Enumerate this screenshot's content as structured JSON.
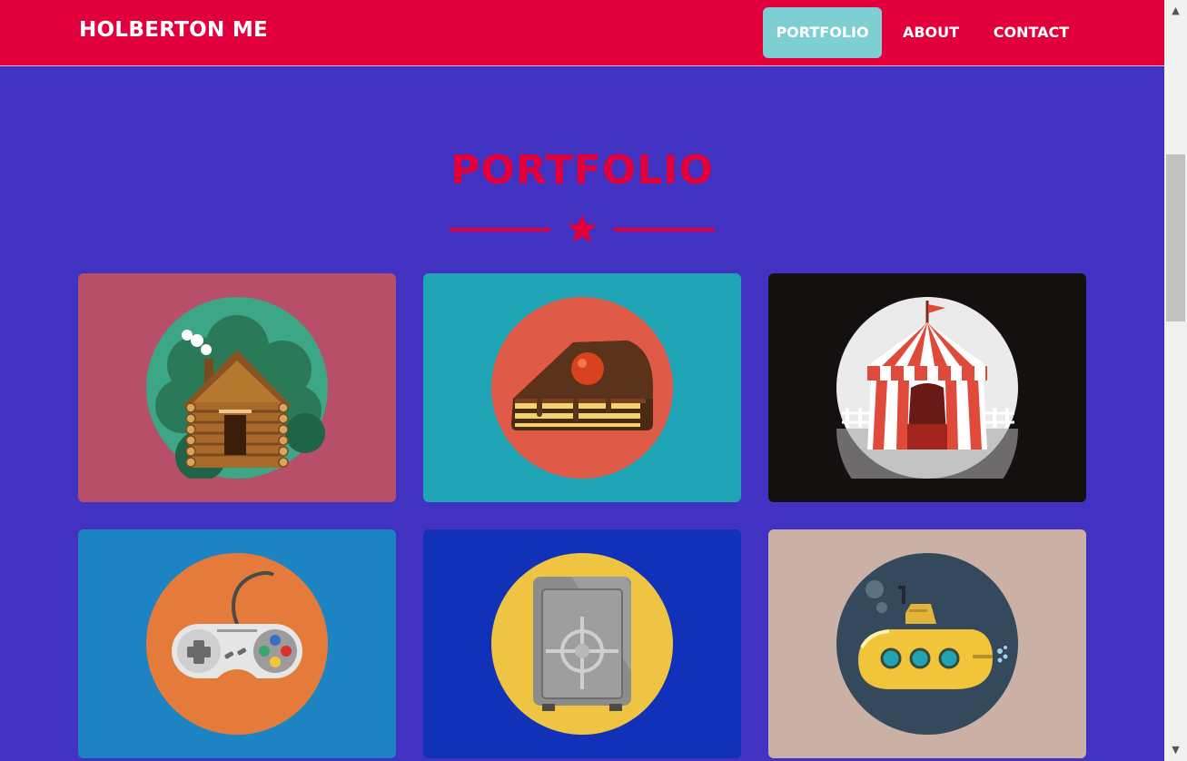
{
  "nav": {
    "brand": "HOLBERTON ME",
    "links": [
      {
        "label": "PORTFOLIO"
      },
      {
        "label": "ABOUT"
      },
      {
        "label": "CONTACT"
      }
    ]
  },
  "portfolio": {
    "title": "PORTFOLIO",
    "items": [
      {
        "name": "Log Cabin",
        "icon": "cabin-icon",
        "bg": "#b84f68",
        "circle": "#3ca687"
      },
      {
        "name": "Cake Slice",
        "icon": "cake-icon",
        "bg": "#1fa4b6",
        "circle": "#e05a48"
      },
      {
        "name": "Circus Tent",
        "icon": "circus-tent-icon",
        "bg": "#141010",
        "circle": "#ebebeb"
      },
      {
        "name": "Game Controller",
        "icon": "game-controller-icon",
        "bg": "#1e83c3",
        "circle": "#e57b3a"
      },
      {
        "name": "Safe",
        "icon": "safe-icon",
        "bg": "#1031b8",
        "circle": "#f0c443"
      },
      {
        "name": "Submarine",
        "icon": "submarine-icon",
        "bg": "#cbb0a5",
        "circle": "#344a5c"
      }
    ]
  },
  "colors": {
    "accent": "#e1003b",
    "page_bg": "#4232c2",
    "active_tab": "#7dcfd2"
  }
}
